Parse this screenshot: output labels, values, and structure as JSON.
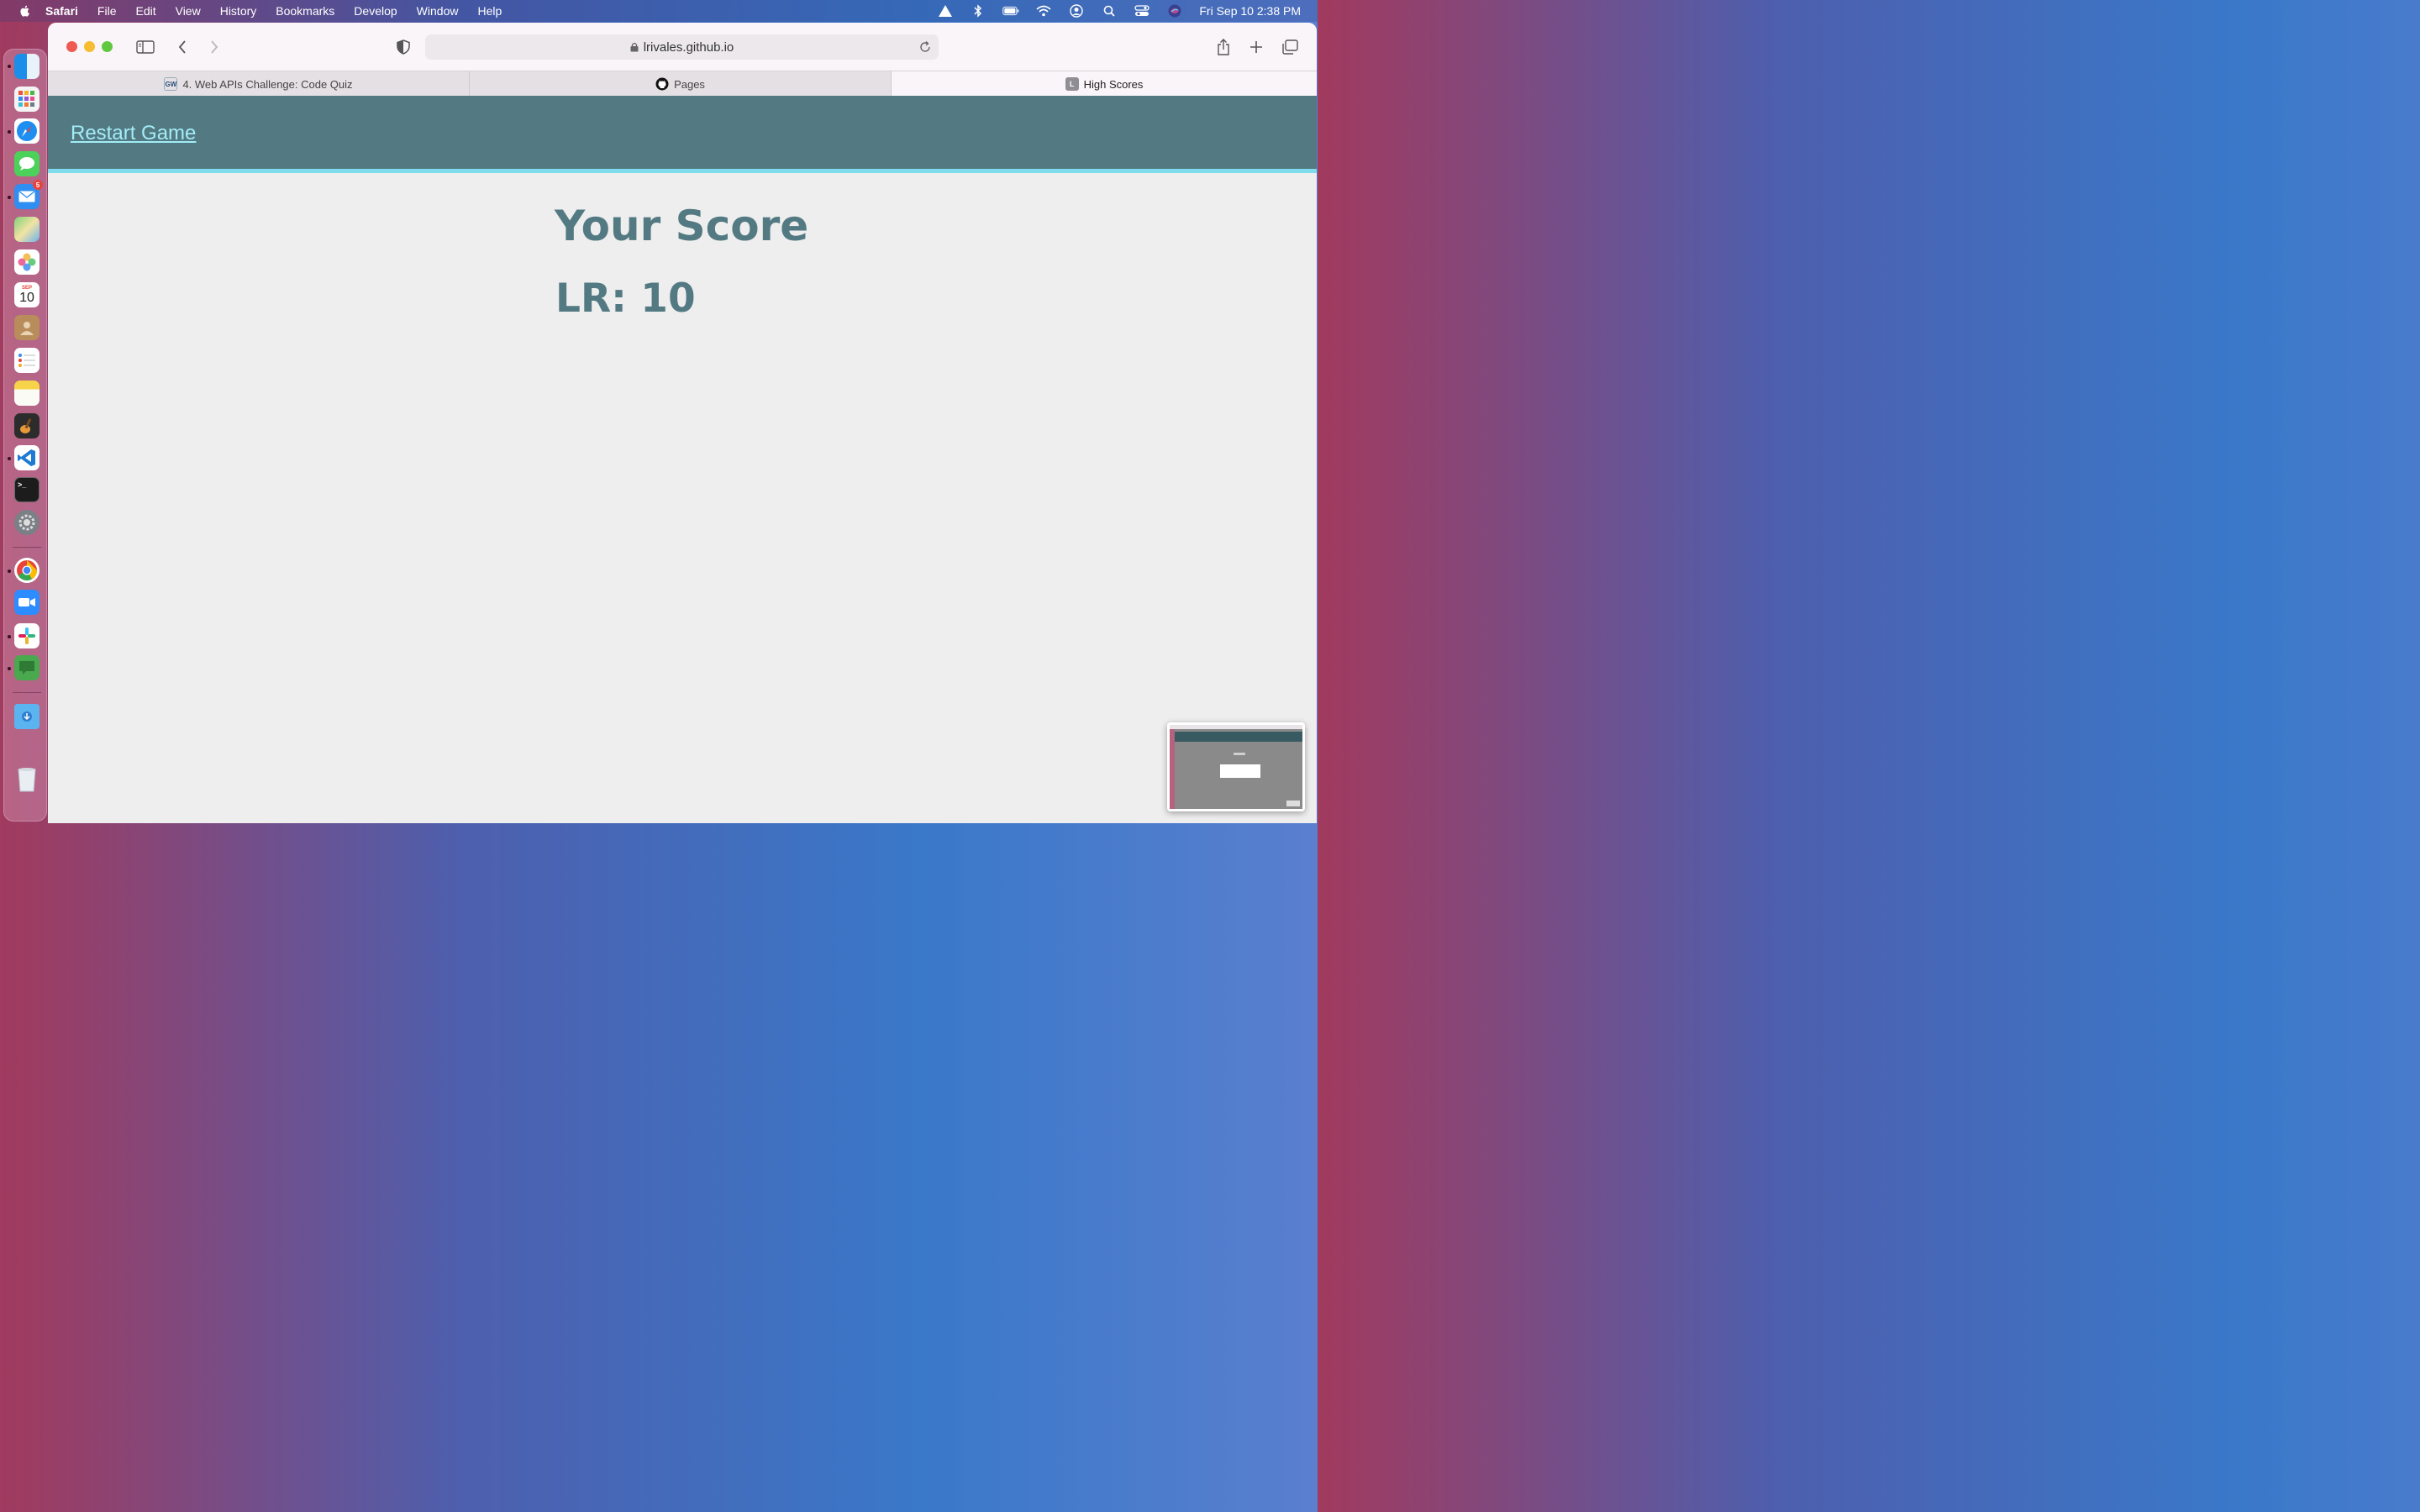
{
  "menubar": {
    "app_name": "Safari",
    "items": [
      "File",
      "Edit",
      "View",
      "History",
      "Bookmarks",
      "Develop",
      "Window",
      "Help"
    ],
    "clock": "Fri Sep 10  2:38 PM"
  },
  "dock": {
    "calendar_month": "SEP",
    "calendar_day": "10",
    "mail_badge": "5"
  },
  "browser": {
    "url": "lrivales.github.io",
    "tabs": [
      {
        "label": "4. Web APIs Challenge: Code Quiz",
        "favicon_text": "GW"
      },
      {
        "label": "Pages",
        "favicon_text": ""
      },
      {
        "label": "High Scores",
        "favicon_text": "L"
      }
    ]
  },
  "page": {
    "restart_label": "Restart Game",
    "title": "Your Score",
    "score_entry": "LR: 10"
  },
  "colors": {
    "header_bg": "#537a82",
    "header_accent": "#7fdcec",
    "link": "#a3ecf6",
    "heading": "#537a82"
  }
}
